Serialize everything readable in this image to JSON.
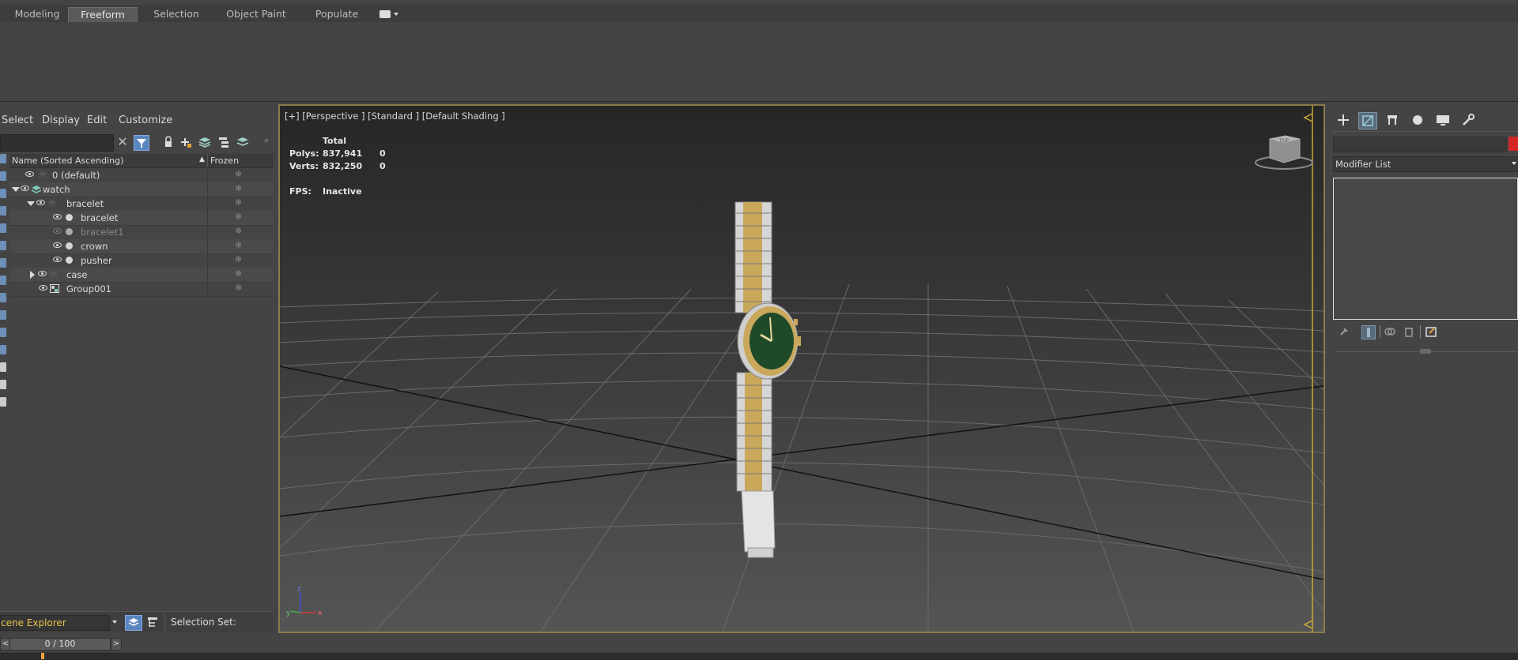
{
  "ribbon": {
    "tabs": [
      {
        "label": "Modeling",
        "active": false
      },
      {
        "label": "Freeform",
        "active": true
      },
      {
        "label": "Selection",
        "active": false
      },
      {
        "label": "Object Paint",
        "active": false
      },
      {
        "label": "Populate",
        "active": false
      }
    ],
    "extra_icon": "camera-dropdown-icon"
  },
  "scene_explorer": {
    "menu": [
      "Select",
      "Display",
      "Edit",
      "Customize"
    ],
    "columns": {
      "name": "Name (Sorted Ascending)",
      "sort_indicator": "▲",
      "frozen": "Frozen"
    },
    "rows": [
      {
        "name": "0 (default)",
        "type": "layer",
        "visible": true,
        "expanded": null
      },
      {
        "name": "watch",
        "type": "layer",
        "visible": true,
        "expanded": true
      },
      {
        "name": "bracelet",
        "type": "layer",
        "visible": true,
        "expanded": true
      },
      {
        "name": "bracelet",
        "type": "object",
        "visible": true
      },
      {
        "name": "bracelet1",
        "type": "object",
        "visible": false
      },
      {
        "name": "crown",
        "type": "object",
        "visible": true
      },
      {
        "name": "pusher",
        "type": "object",
        "visible": true
      },
      {
        "name": "case",
        "type": "layer",
        "visible": true,
        "expanded": false
      },
      {
        "name": "Group001",
        "type": "group",
        "visible": true
      }
    ],
    "footer": {
      "dropdown": "cene Explorer",
      "selection_set_label": "Selection Set:"
    },
    "time_slider": {
      "text": "0 / 100",
      "prev": "<",
      "next": ">"
    }
  },
  "viewport": {
    "label": "[+] [Perspective ] [Standard ] [Default Shading ]",
    "stats": {
      "header": "Total",
      "polys_label": "Polys:",
      "polys_total": "837,941",
      "polys_sel": "0",
      "verts_label": "Verts:",
      "verts_total": "832,250",
      "verts_sel": "0",
      "fps_label": "FPS:",
      "fps_value": "Inactive"
    },
    "viewcube_face": "TOP",
    "axis": {
      "z": "z",
      "x": "x",
      "y": "y"
    },
    "colors": {
      "border": "#8c7b4a",
      "watch_dial": "#1f4a2a",
      "gold": "#c9a85c",
      "steel": "#d8d8d8"
    }
  },
  "command_panel": {
    "tabs": [
      "create-icon",
      "modify-icon",
      "hierarchy-icon",
      "motion-icon",
      "display-icon",
      "utilities-icon"
    ],
    "modifier_list": "Modifier List",
    "color_swatch": "#d42626"
  }
}
